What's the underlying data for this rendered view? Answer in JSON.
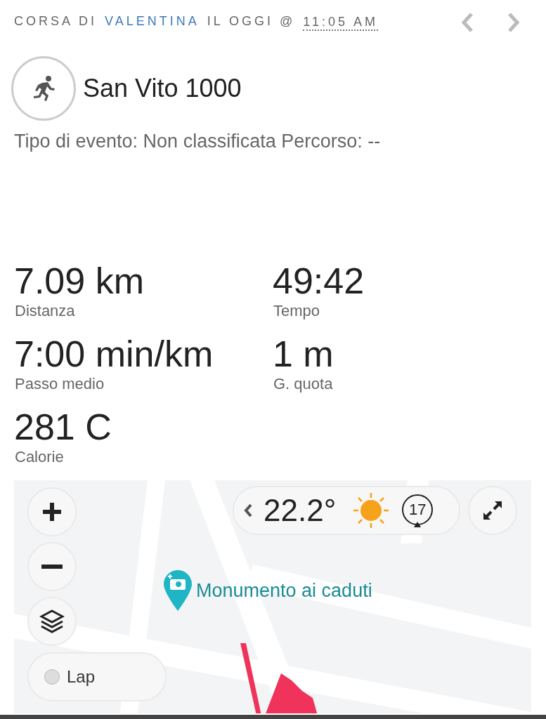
{
  "header": {
    "prefix": "CORSA DI",
    "athlete": "VALENTINA",
    "middle": "IL OGGI @",
    "time": "11:05 AM"
  },
  "activity": {
    "title": "San Vito 1000",
    "details": "Tipo di evento: Non classificata Percorso: --"
  },
  "stats": [
    {
      "value": "7.09 km",
      "label": "Distanza"
    },
    {
      "value": "49:42",
      "label": "Tempo"
    },
    {
      "value": "7:00 min/km",
      "label": "Passo medio"
    },
    {
      "value": "1 m",
      "label": "G. quota"
    },
    {
      "value": "281 C",
      "label": "Calorie"
    }
  ],
  "map": {
    "weather": {
      "temperature": "22.2°",
      "wind": "17"
    },
    "marker": {
      "label": "Monumento ai caduti"
    },
    "lap": {
      "label": "Lap",
      "checked": false
    }
  }
}
